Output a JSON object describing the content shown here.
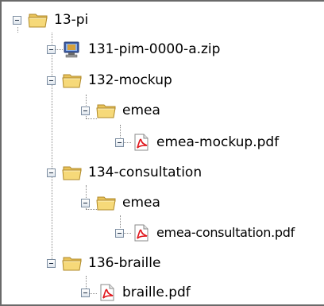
{
  "tree": {
    "root": {
      "label": "13-pi",
      "children": [
        {
          "label": "131-pim-0000-a.zip",
          "icon": "zip-archive-icon"
        },
        {
          "label": "132-mockup",
          "icon": "folder-icon",
          "children": [
            {
              "label": "emea",
              "icon": "folder-icon",
              "children": [
                {
                  "label": "emea-mockup.pdf",
                  "icon": "pdf-file-icon"
                }
              ]
            }
          ]
        },
        {
          "label": "134-consultation",
          "icon": "folder-icon",
          "children": [
            {
              "label": "emea",
              "icon": "folder-icon",
              "children": [
                {
                  "label": "emea-consultation.pdf",
                  "icon": "pdf-file-icon"
                }
              ]
            }
          ]
        },
        {
          "label": "136-braille",
          "icon": "folder-icon",
          "children": [
            {
              "label": "braille.pdf",
              "icon": "pdf-file-icon"
            }
          ]
        }
      ]
    }
  }
}
